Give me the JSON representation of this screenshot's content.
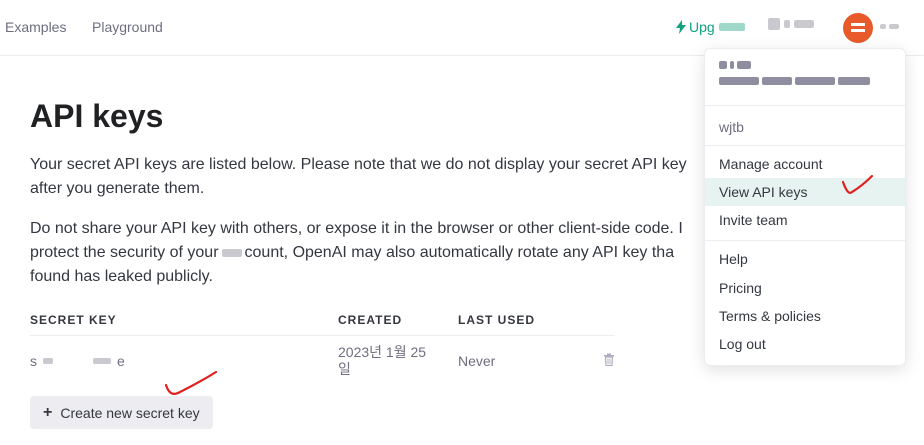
{
  "nav": {
    "links": [
      "Examples",
      "Playground"
    ],
    "upgrade_label": "Upg"
  },
  "page": {
    "title": "API keys",
    "para1_line1": "Your secret API keys are listed below. Please note that we do not display your secret API key",
    "para1_line2": "after you generate them.",
    "para2_line1": "Do not share your API key with others, or expose it in the browser or other client-side code. I",
    "para2_line2_a": "protect the security of your",
    "para2_line2_b": "count, OpenAI may also automatically rotate any API key tha",
    "para2_line3": "found has leaked publicly."
  },
  "table": {
    "headers": [
      "SECRET KEY",
      "CREATED",
      "LAST USED"
    ],
    "rows": [
      {
        "key_prefix": "s",
        "key_suffix": "e",
        "created_line1": "2023년 1월 25",
        "created_line2": "일",
        "last_used": "Never"
      }
    ]
  },
  "create_button": {
    "label": "Create new secret key"
  },
  "dropdown": {
    "org": "wjtb",
    "group1": [
      "Manage account",
      "View API keys",
      "Invite team"
    ],
    "group2": [
      "Help",
      "Pricing",
      "Terms & policies",
      "Log out"
    ],
    "active": "View API keys"
  },
  "colors": {
    "accent": "#10a37f",
    "avatar": "#e85a2a",
    "active_item_bg": "#e6f3f0",
    "annotation_red": "#e02020"
  },
  "icons": {
    "upgrade": "bolt-icon",
    "delete": "trash-icon",
    "add": "plus-icon"
  }
}
